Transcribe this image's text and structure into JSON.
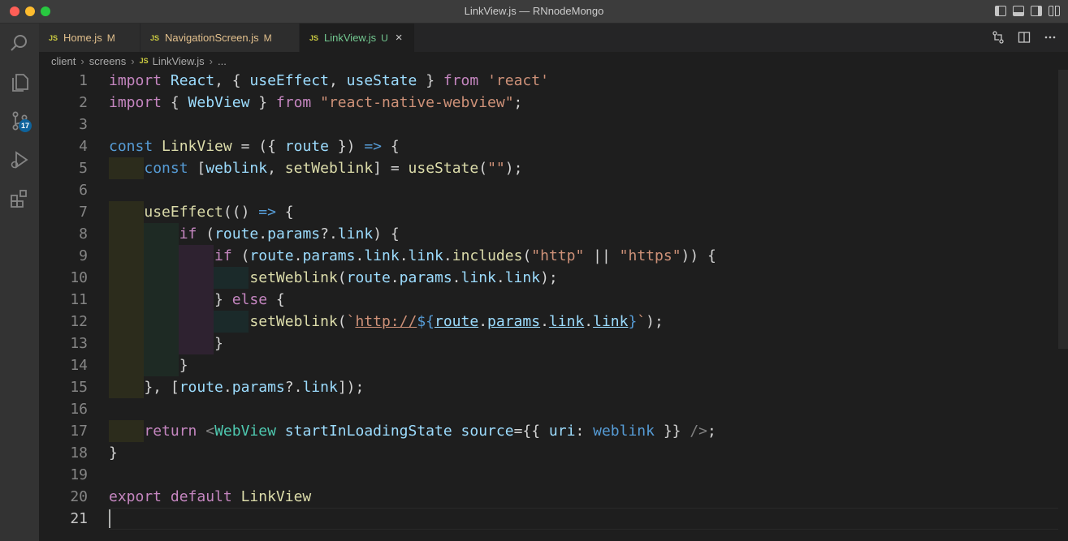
{
  "window": {
    "title": "LinkView.js — RNnodeMongo"
  },
  "activity_bar": {
    "items": [
      {
        "icon": "explorer-search-icon"
      },
      {
        "icon": "files-icon"
      },
      {
        "icon": "source-control-icon",
        "badge": "17"
      },
      {
        "icon": "run-debug-icon"
      },
      {
        "icon": "extensions-icon"
      }
    ]
  },
  "tabs": [
    {
      "type": "JS",
      "label": "Home.js",
      "status": "M",
      "active": false
    },
    {
      "type": "JS",
      "label": "NavigationScreen.js",
      "status": "M",
      "active": false
    },
    {
      "type": "JS",
      "label": "LinkView.js",
      "status": "U",
      "active": true,
      "close": "×"
    }
  ],
  "breadcrumb": {
    "parts": [
      "client",
      "screens",
      "LinkView.js",
      "..."
    ],
    "file_type": "JS"
  },
  "editor": {
    "line_numbers": [
      "1",
      "2",
      "3",
      "4",
      "5",
      "6",
      "7",
      "8",
      "9",
      "10",
      "11",
      "12",
      "13",
      "14",
      "15",
      "16",
      "17",
      "18",
      "19",
      "20",
      "21"
    ],
    "current_line": 21
  },
  "colors": {
    "keyword": "#c586c0",
    "storage": "#569cd6",
    "variable": "#9cdcfe",
    "function": "#dcdcaa",
    "string": "#ce9178",
    "component": "#4ec9b0",
    "background": "#1e1e1e"
  }
}
